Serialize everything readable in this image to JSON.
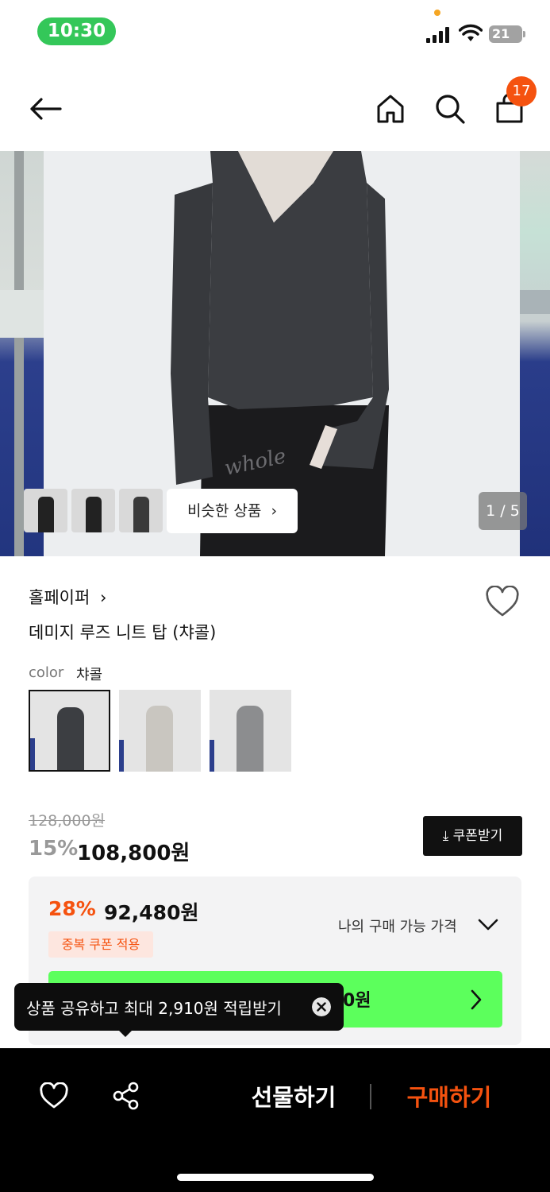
{
  "status_bar": {
    "time": "10:30",
    "battery": "21"
  },
  "header": {
    "cart_count": "17"
  },
  "gallery": {
    "similar_label": "비슷한 상품",
    "page_indicator": "1 / 5",
    "thumbnail_count": 3
  },
  "product": {
    "brand": "홀페이퍼",
    "name": "데미지 루즈 니트 탑 (챠콜)",
    "color_label": "color",
    "color_value": "챠콜",
    "swatches": [
      {
        "color": "#3c3e42",
        "selected": true
      },
      {
        "color": "#c9c6c0",
        "selected": false
      },
      {
        "color": "#8c8d8f",
        "selected": false
      }
    ]
  },
  "pricing": {
    "original_price": "128,000원",
    "discount_rate": "15%",
    "sale_price": "108,800원",
    "coupon_button": "쿠폰받기",
    "my_rate": "28%",
    "my_price": "92,480원",
    "duplicate_coupon": "중복 쿠폰 적용",
    "my_price_label": "나의 구매 가능 가격",
    "green_bar_text": "0원"
  },
  "toast": {
    "text": "상품 공유하고 최대 2,910원 적립받기"
  },
  "bottom_bar": {
    "gift": "선물하기",
    "buy": "구매하기"
  },
  "colors": {
    "accent": "#f5520f",
    "green": "#5cff5c",
    "status_green": "#34c759"
  }
}
